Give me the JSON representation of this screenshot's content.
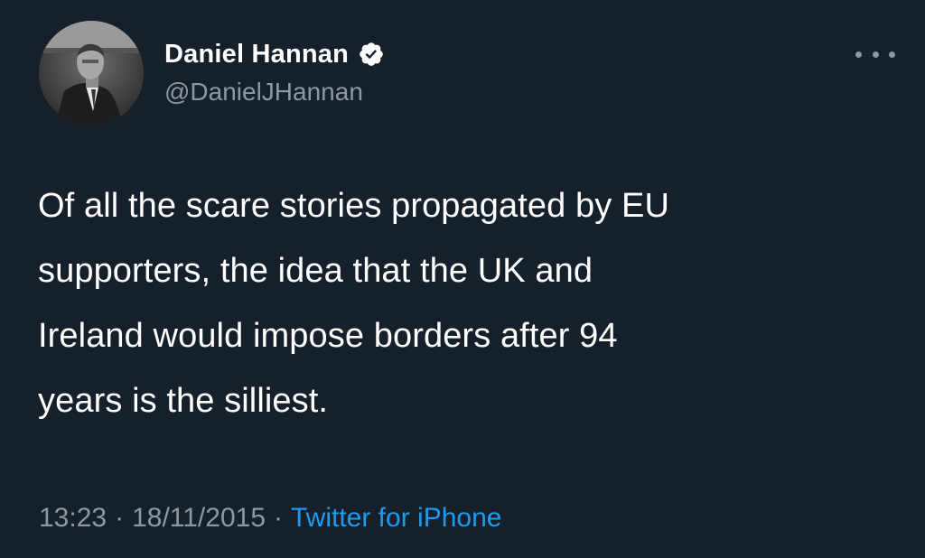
{
  "tweet": {
    "display_name": "Daniel Hannan",
    "handle": "@DanielJHannan",
    "verified": true,
    "verified_icon": "verified-badge-icon",
    "text_lines": [
      "Of all the scare stories propagated by EU",
      "supporters, the idea that the UK and",
      "Ireland would impose borders after 94",
      "years is the silliest."
    ],
    "time": "13:23",
    "date": "18/11/2015",
    "separator": "·",
    "source": "Twitter for iPhone"
  },
  "theme": {
    "background": "#15202b",
    "primary_text": "#ffffff",
    "secondary_text": "#8b98a5",
    "link": "#1d9bf0"
  },
  "icons": {
    "more": "more-options-icon",
    "avatar": "profile-photo"
  }
}
